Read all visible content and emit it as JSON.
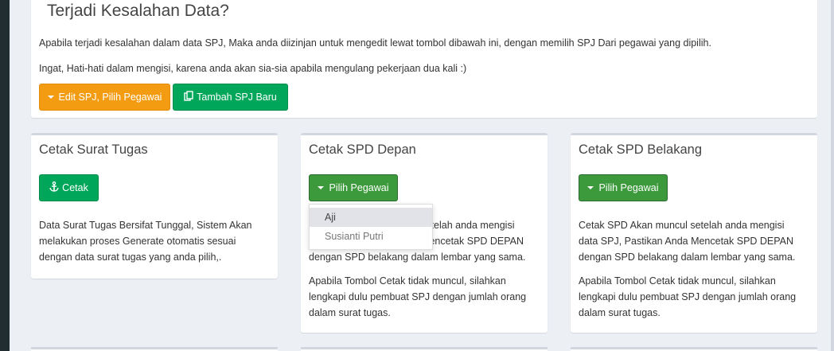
{
  "top": {
    "title": "Terjadi Kesalahan Data?",
    "line1": "Apabila terjadi kesalahan dalam data SPJ, Maka anda diizinjan untuk mengedit lewat tombol dibawah ini, dengan memilih SPJ Dari pegawai yang dipilih.",
    "line2": "Ingat, Hati-hati dalam mengisi, karena anda akan sia-sia apabila mengulang pekerjaan dua kali :)",
    "edit_button": "Edit SPJ, Pilih Pegawai",
    "add_button": "Tambah SPJ Baru"
  },
  "cards": [
    {
      "title": "Cetak Surat Tugas",
      "button": "Cetak",
      "text": [
        "Data Surat Tugas Bersifat Tunggal, Sistem Akan",
        "melakukan proses Generate otomatis sesuai",
        "dengan data surat tugas yang anda pilih,."
      ]
    },
    {
      "title": "Cetak SPD Depan",
      "button": "Pilih Pegawai",
      "text": [
        "Cetak SPD Akan muncul setelah anda mengisi",
        "data SPJ, Pastikan Anda Mencetak SPD DEPAN",
        "dengan SPD belakang dalam lembar yang sama."
      ],
      "text2": [
        "Apabila Tombol Cetak tidak muncul, silahkan",
        "lengkapi dulu pembuat SPJ dengan jumlah orang",
        "dalam surat tugas."
      ]
    },
    {
      "title": "Cetak SPD Belakang",
      "button": "Pilih Pegawai",
      "text": [
        "Cetak SPD Akan muncul setelah anda mengisi",
        "data SPJ, Pastikan Anda Mencetak SPD DEPAN",
        "dengan SPD belakang dalam lembar yang sama."
      ],
      "text2": [
        "Apabila Tombol Cetak tidak muncul, silahkan",
        "lengkapi dulu pembuat SPJ dengan jumlah orang",
        "dalam surat tugas."
      ]
    }
  ],
  "dropdown": {
    "items": [
      "Aji",
      "Susianti Putri"
    ]
  },
  "icons": {
    "edit": "caret-down-icon",
    "add": "copy-icon",
    "print": "anchor-icon"
  }
}
